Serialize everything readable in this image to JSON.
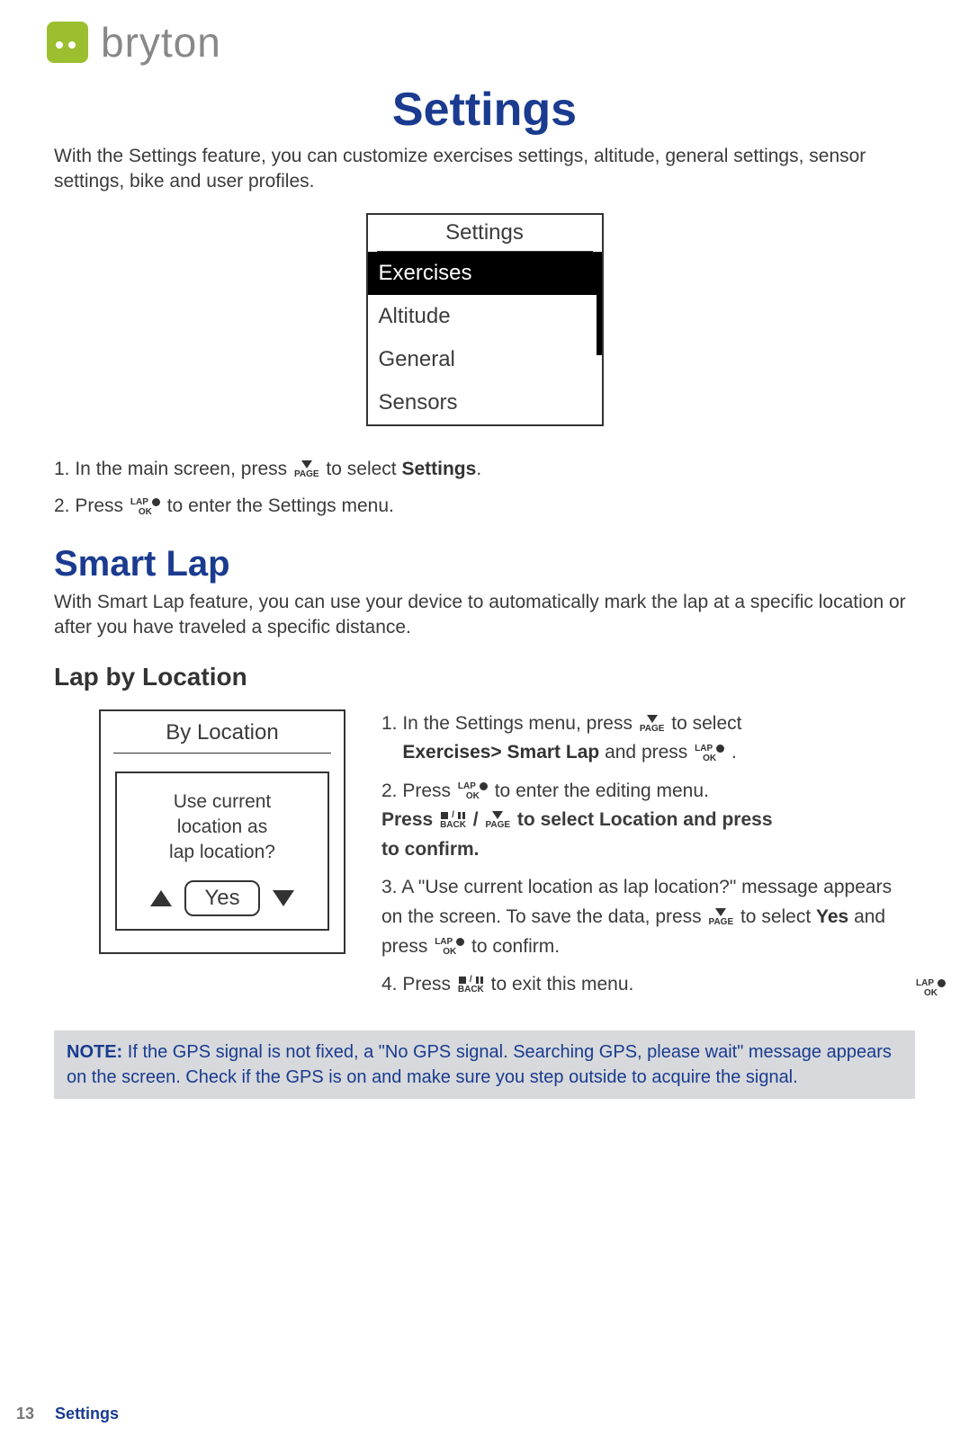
{
  "logo": {
    "brand": "bryton"
  },
  "title_main": "Settings",
  "intro": "With the Settings feature, you can customize exercises settings, altitude, general settings, sensor settings, bike and user profiles.",
  "device1": {
    "title": "Settings",
    "items": [
      "Exercises",
      "Altitude",
      "General",
      "Sensors"
    ]
  },
  "buttons": {
    "page": "PAGE",
    "lap": "LAP",
    "ok": "OK",
    "back": "BACK"
  },
  "steps_main": {
    "s1_pre": "1.  In the main screen, press ",
    "s1_post_a": " to select ",
    "s1_bold": "Settings",
    "s1_post_b": ".",
    "s2_pre": "2.  Press ",
    "s2_post": " to enter the Settings menu."
  },
  "smart_lap": {
    "heading": "Smart Lap",
    "lead": "With Smart Lap feature, you can use your device to automatically mark the lap at a specific location or after you have traveled a specific distance.",
    "sub_heading": "Lap by Location"
  },
  "device2": {
    "title": "By Location",
    "message_l1": "Use current",
    "message_l2": "location as",
    "message_l3": "lap location?",
    "yes": "Yes"
  },
  "steps_right": {
    "s1_a": "1.  In the Settings menu, press ",
    "s1_b": " to select",
    "s1_line2_a": "Exercises> Smart Lap",
    "s1_line2_b": " and press ",
    "s1_line2_c": ".",
    "s2_a": "2.  Press ",
    "s2_b": " to enter the editing menu.",
    "s2_sub_a": "Press ",
    "s2_sub_b": " / ",
    "s2_sub_c": "to select  Location and press",
    "s2_sub_d": "to confirm.",
    "s3": "3.  A \"Use current location as lap location?\" message appears on the screen. To save the data, press ",
    "s3_b": " to select ",
    "s3_yes": "Yes",
    "s3_c": " and press ",
    "s3_d": " to confirm.",
    "s4_a": "4.  Press ",
    "s4_b": " to exit this menu."
  },
  "note": {
    "label": "NOTE:",
    "text": " If the GPS signal is not fixed, a \"No GPS signal. Searching GPS, please wait\" message appears on the screen. Check if the GPS is on and make sure you step outside to acquire the signal."
  },
  "footer": {
    "page": "13",
    "section": "Settings"
  }
}
